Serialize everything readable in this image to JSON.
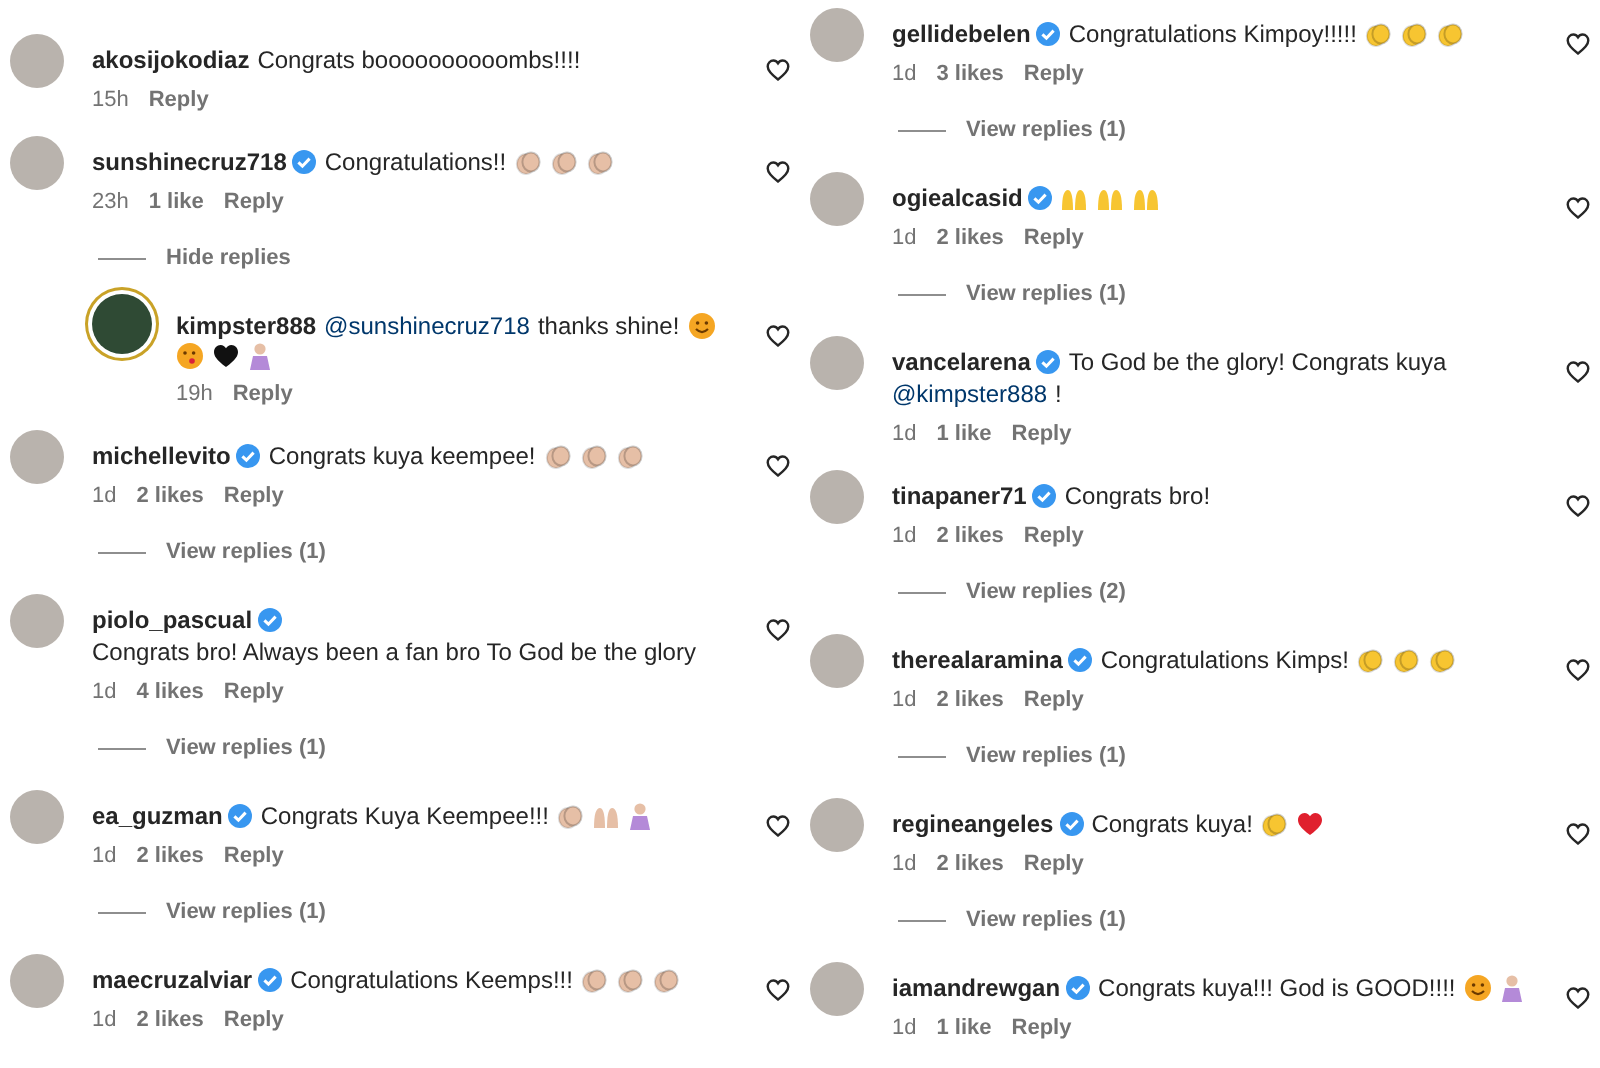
{
  "columns": [
    {
      "comments": [
        {
          "username": "akosijokodiaz",
          "verified": false,
          "parts": [
            {
              "kind": "text",
              "text": "Congrats boooooooooombs!!!!"
            }
          ],
          "time": "15h",
          "reply": "Reply"
        },
        {
          "username": "sunshinecruz718",
          "verified": true,
          "parts": [
            {
              "kind": "text",
              "text": "Congratulations!!"
            },
            {
              "kind": "clap",
              "color": "#e6bfa6"
            },
            {
              "kind": "clap",
              "color": "#e6bfa6"
            },
            {
              "kind": "clap",
              "color": "#e6bfa6"
            }
          ],
          "time": "23h",
          "likes": "1 like",
          "reply": "Reply",
          "replies_toggle": {
            "label": "Hide replies"
          },
          "replies": [
            {
              "username": "kimpster888",
              "verified": false,
              "avatar_ring": true,
              "parts": [
                {
                  "kind": "mention",
                  "text": "@sunshinecruz718"
                },
                {
                  "kind": "text",
                  "text": "thanks shine!"
                },
                {
                  "kind": "smiley",
                  "color": "#f5a623"
                },
                {
                  "kind": "kiss",
                  "color": "#f5a623"
                },
                {
                  "kind": "heart",
                  "color": "#111111"
                },
                {
                  "kind": "person",
                  "color": "#b48ad8"
                }
              ],
              "time": "19h",
              "reply": "Reply"
            }
          ]
        },
        {
          "username": "michellevito",
          "verified": true,
          "parts": [
            {
              "kind": "text",
              "text": "Congrats kuya keempee!"
            },
            {
              "kind": "clap",
              "color": "#e6bfa6"
            },
            {
              "kind": "clap",
              "color": "#e6bfa6"
            },
            {
              "kind": "clap",
              "color": "#e6bfa6"
            }
          ],
          "time": "1d",
          "likes": "2 likes",
          "reply": "Reply",
          "replies_toggle": {
            "label": "View replies (1)"
          }
        },
        {
          "username": "piolo_pascual",
          "verified": true,
          "parts": [
            {
              "kind": "text",
              "text": "Congrats bro! Always been a fan bro To God be the glory"
            }
          ],
          "time": "1d",
          "likes": "4 likes",
          "reply": "Reply",
          "replies_toggle": {
            "label": "View replies (1)"
          }
        },
        {
          "username": "ea_guzman",
          "verified": true,
          "parts": [
            {
              "kind": "text",
              "text": "Congrats Kuya Keempee!!!"
            },
            {
              "kind": "clap",
              "color": "#e6bfa6"
            },
            {
              "kind": "raised-hands",
              "color": "#e6bfa6"
            },
            {
              "kind": "person",
              "color": "#b48ad8"
            }
          ],
          "time": "1d",
          "likes": "2 likes",
          "reply": "Reply",
          "replies_toggle": {
            "label": "View replies (1)"
          }
        },
        {
          "username": "maecruzalviar",
          "verified": true,
          "parts": [
            {
              "kind": "text",
              "text": "Congratulations Keemps!!!"
            },
            {
              "kind": "clap",
              "color": "#e6bfa6"
            },
            {
              "kind": "clap",
              "color": "#e6bfa6"
            },
            {
              "kind": "clap",
              "color": "#e6bfa6"
            }
          ],
          "time": "1d",
          "likes": "2 likes",
          "reply": "Reply"
        }
      ]
    },
    {
      "comments": [
        {
          "username": "gellidebelen",
          "verified": true,
          "parts": [
            {
              "kind": "text",
              "text": "Congratulations Kimpoy!!!!!"
            },
            {
              "kind": "clap",
              "color": "#f7c531"
            },
            {
              "kind": "clap",
              "color": "#f7c531"
            },
            {
              "kind": "clap",
              "color": "#f7c531"
            }
          ],
          "time": "1d",
          "likes": "3 likes",
          "reply": "Reply",
          "replies_toggle": {
            "label": "View replies (1)"
          }
        },
        {
          "username": "ogiealcasid",
          "verified": true,
          "parts": [
            {
              "kind": "raised-hands",
              "color": "#f7c531"
            },
            {
              "kind": "raised-hands",
              "color": "#f7c531"
            },
            {
              "kind": "raised-hands",
              "color": "#f7c531"
            }
          ],
          "time": "1d",
          "likes": "2 likes",
          "reply": "Reply",
          "replies_toggle": {
            "label": "View replies (1)"
          }
        },
        {
          "username": "vancelarena",
          "verified": true,
          "parts": [
            {
              "kind": "text",
              "text": "To God be the glory! Congrats kuya"
            },
            {
              "kind": "mention",
              "text": "@kimpster888"
            },
            {
              "kind": "text",
              "text": "!"
            }
          ],
          "time": "1d",
          "likes": "1 like",
          "reply": "Reply"
        },
        {
          "username": "tinapaner71",
          "verified": true,
          "parts": [
            {
              "kind": "text",
              "text": "Congrats bro!"
            }
          ],
          "time": "1d",
          "likes": "2 likes",
          "reply": "Reply",
          "replies_toggle": {
            "label": "View replies (2)"
          }
        },
        {
          "username": "therealaramina",
          "verified": true,
          "parts": [
            {
              "kind": "text",
              "text": "Congratulations Kimps!"
            },
            {
              "kind": "clap",
              "color": "#f7c531"
            },
            {
              "kind": "clap",
              "color": "#f7c531"
            },
            {
              "kind": "clap",
              "color": "#f7c531"
            }
          ],
          "time": "1d",
          "likes": "2 likes",
          "reply": "Reply",
          "replies_toggle": {
            "label": "View replies (1)"
          }
        },
        {
          "username": "regineangeles",
          "verified": true,
          "parts": [
            {
              "kind": "text",
              "text": "Congrats kuya!"
            },
            {
              "kind": "clap",
              "color": "#f7c531"
            },
            {
              "kind": "heart",
              "color": "#e0202e"
            }
          ],
          "time": "1d",
          "likes": "2 likes",
          "reply": "Reply",
          "replies_toggle": {
            "label": "View replies (1)"
          }
        },
        {
          "username": "iamandrewgan",
          "verified": true,
          "parts": [
            {
              "kind": "text",
              "text": "Congrats kuya!!! God is GOOD!!!!"
            },
            {
              "kind": "smiley",
              "color": "#f5a623"
            },
            {
              "kind": "person",
              "color": "#b48ad8"
            }
          ],
          "time": "1d",
          "likes": "1 like",
          "reply": "Reply"
        }
      ]
    }
  ]
}
